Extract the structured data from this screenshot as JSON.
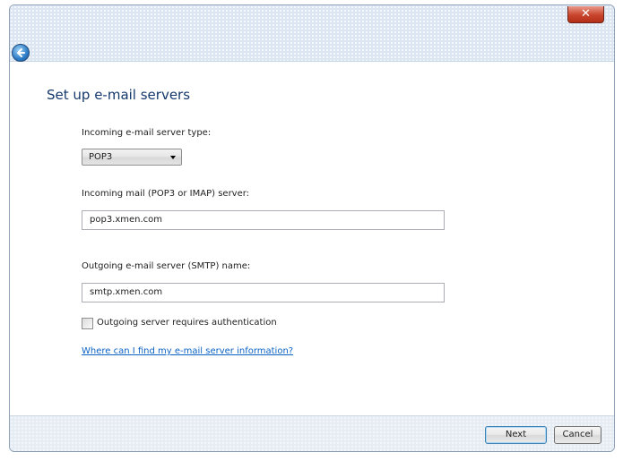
{
  "window": {
    "close_glyph": "✕"
  },
  "page": {
    "title": "Set up e-mail servers"
  },
  "incoming_type": {
    "label": "Incoming e-mail server type:",
    "selected": "POP3",
    "options": [
      "POP3"
    ]
  },
  "incoming_server": {
    "label": "Incoming mail (POP3 or IMAP) server:",
    "value": "pop3.xmen.com"
  },
  "outgoing_server": {
    "label": "Outgoing e-mail server (SMTP) name:",
    "value": "smtp.xmen.com"
  },
  "auth": {
    "label": "Outgoing server requires authentication",
    "checked": false
  },
  "help_link": "Where can I find my e-mail server information?",
  "footer": {
    "next_label": "Next",
    "cancel_label": "Cancel"
  },
  "colors": {
    "title_text": "#14386c",
    "link": "#0b62c4",
    "close_button": "#c8442c"
  },
  "icons": {
    "back": "back-arrow-icon",
    "close": "close-icon",
    "dropdown": "chevron-down-icon"
  }
}
